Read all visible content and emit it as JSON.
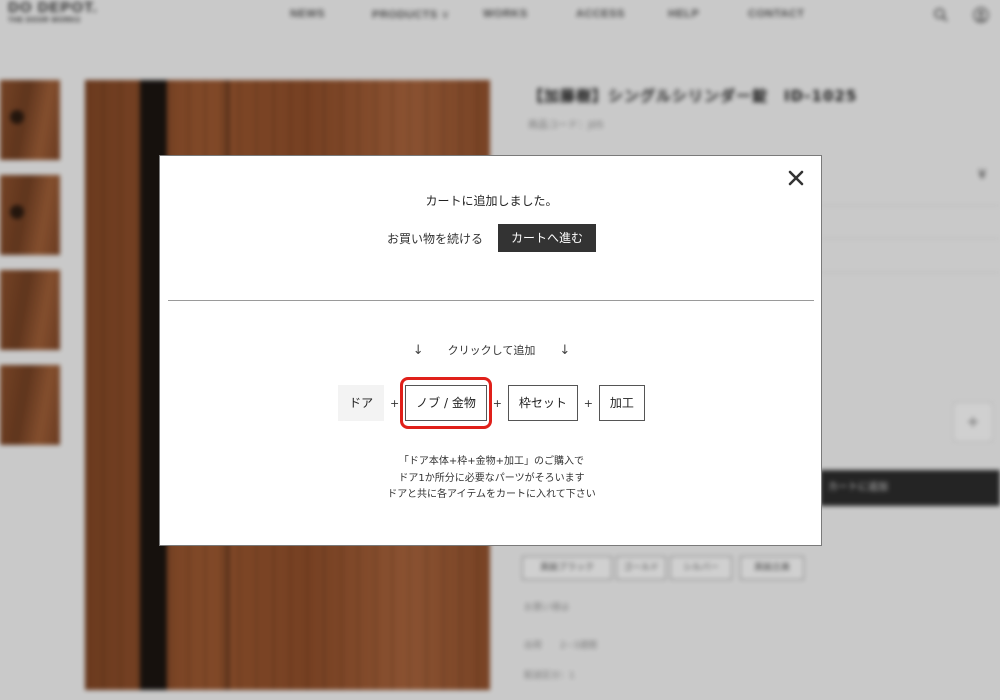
{
  "header": {
    "logo_line1": "DO DEPOT.",
    "logo_line2": "THE DOOR WORKS",
    "nav": [
      "NEWS",
      "PRODUCTS",
      "WORKS",
      "ACCESS",
      "HELP",
      "CONTACT"
    ],
    "nav_products_caret": "∨"
  },
  "product": {
    "title": "【加藤樹】シングルシリンダー錠　ID-1025",
    "subtitle": "商品コード：J05",
    "price_peek": "¥",
    "qty_control": "+",
    "cart_bar_text": "カートに追加",
    "tags": [
      "真鍮ブラック",
      "ゴールド",
      "シルバー",
      "真鍮古美"
    ],
    "info_lines": [
      "お買い得は",
      "出荷　　2~3週間",
      "配送区分：1"
    ]
  },
  "modal": {
    "message": "カートに追加しました。",
    "continue_label": "お買い物を続ける",
    "to_cart_label": "カートへ進む",
    "hint_arrow_left": "↓",
    "hint_text": "クリックして追加",
    "hint_arrow_right": "↓",
    "parts": [
      {
        "label": "ドア",
        "state": "current"
      },
      {
        "label": "ノブ / 金物",
        "state": "highlighted"
      },
      {
        "label": "枠セット",
        "state": "normal"
      },
      {
        "label": "加工",
        "state": "normal"
      }
    ],
    "plus": "+",
    "note_lines": [
      "「ドア本体+枠+金物+加工」のご購入で",
      "ドア1か所分に必要なパーツがそろいます",
      "ドアと共に各アイテムをカートに入れて下さい"
    ]
  },
  "colors": {
    "highlight": "#e0201a",
    "button_dark": "#333333"
  },
  "icons": {
    "close": "close-icon",
    "search": "search-icon",
    "user": "user-icon"
  }
}
